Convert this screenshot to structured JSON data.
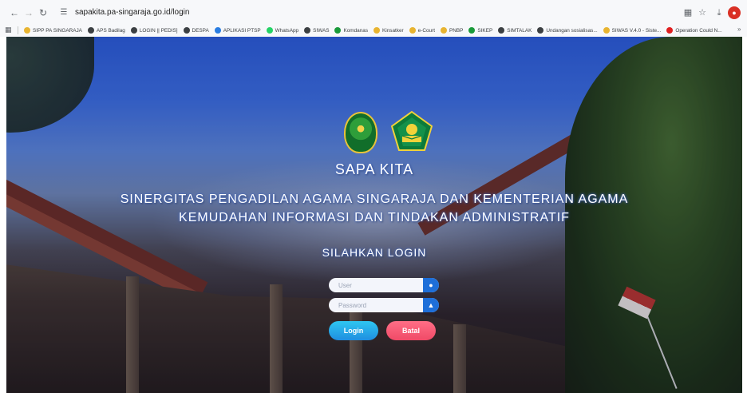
{
  "browser": {
    "url": "sapakita.pa-singaraja.go.id/login",
    "bookmarks": [
      {
        "label": "SIPP PA SINGARAJA",
        "color": "#e8b431"
      },
      {
        "label": "APS Badilag",
        "color": "#3c4043"
      },
      {
        "label": "LOGIN || PEDIS]",
        "color": "#3c4043"
      },
      {
        "label": "DESPA",
        "color": "#3c4043"
      },
      {
        "label": "APLIKASI PTSP",
        "color": "#2a7de1"
      },
      {
        "label": "WhatsApp",
        "color": "#25d366"
      },
      {
        "label": "SIWAS",
        "color": "#3c4043"
      },
      {
        "label": "Komdanas",
        "color": "#1a9a3a"
      },
      {
        "label": "Kinsatker",
        "color": "#e8b431"
      },
      {
        "label": "e-Court",
        "color": "#e8b431"
      },
      {
        "label": "PNBP",
        "color": "#e8b431"
      },
      {
        "label": "SIKEP",
        "color": "#1a9a3a"
      },
      {
        "label": "SIMTALAK",
        "color": "#3c4043"
      },
      {
        "label": "Undangan sosialisas...",
        "color": "#3c4043"
      },
      {
        "label": "SIWAS V.4.0 - Siste...",
        "color": "#e8b431"
      },
      {
        "label": "Operation Could N...",
        "color": "#e02020"
      }
    ]
  },
  "page": {
    "title": "SAPA KITA",
    "subtitle_line1": "SINERGITAS PENGADILAN AGAMA SINGARAJA DAN KEMENTERIAN AGAMA",
    "subtitle_line2": "KEMUDAHAN INFORMASI DAN TINDAKAN ADMINISTRATIF",
    "prompt": "SILAHKAN LOGIN"
  },
  "form": {
    "user_placeholder": "User",
    "password_placeholder": "Password",
    "login_label": "Login",
    "cancel_label": "Batal"
  },
  "colors": {
    "login_button": "#1f8ee0",
    "cancel_button": "#f04a67",
    "field_icon": "#1e6fd9"
  }
}
